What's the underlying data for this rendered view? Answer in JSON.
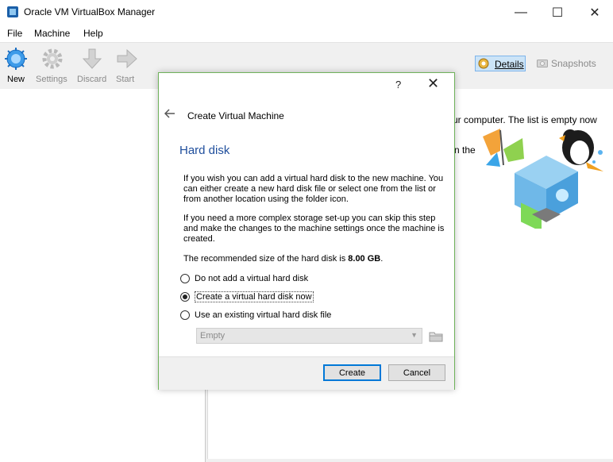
{
  "window": {
    "title": "Oracle VM VirtualBox Manager",
    "minimize": "—",
    "maximize": "☐",
    "close": "✕"
  },
  "menu": [
    "File",
    "Machine",
    "Help"
  ],
  "toolbar": {
    "new": "New",
    "settings": "Settings",
    "discard": "Discard",
    "start": "Start",
    "details": "Details",
    "snapshots": "Snapshots"
  },
  "background_text": {
    "line1": "ur computer. The list is empty now",
    "line2": "n the"
  },
  "dialog": {
    "help": "?",
    "close": "✕",
    "back_icon": "arrow-left-icon",
    "heading": "Create Virtual Machine",
    "page_title": "Hard disk",
    "para1": "If you wish you can add a virtual hard disk to the new machine. You can either create a new hard disk file or select one from the list or from another location using the folder icon.",
    "para2": "If you need a more complex storage set-up you can skip this step and make the changes to the machine settings once the machine is created.",
    "recommend_prefix": "The recommended size of the hard disk is ",
    "recommend_size": "8.00 GB",
    "recommend_suffix": ".",
    "options": [
      "Do not add a virtual hard disk",
      "Create a virtual hard disk now",
      "Use an existing virtual hard disk file"
    ],
    "selected_option": 1,
    "combo_value": "Empty",
    "create_label": "Create",
    "cancel_label": "Cancel"
  },
  "colors": {
    "accent": "#1f4e9c",
    "dialog_border": "#6fb25b",
    "arrow": "#e02020",
    "default_button": "#0078d7"
  }
}
